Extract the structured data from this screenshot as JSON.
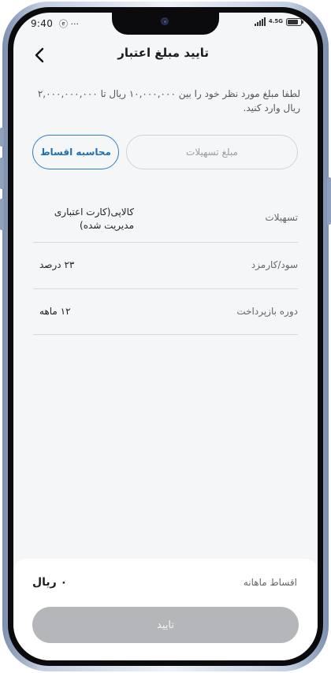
{
  "status_bar": {
    "time": "9:40",
    "left_icons": "ⓔ ···",
    "network_label": "4.5G",
    "battery_level": 0.85
  },
  "header": {
    "title": "تایید مبلغ اعتبار"
  },
  "description": "لطفا مبلغ مورد نظر خود را بین ۱۰,۰۰۰,۰۰۰ ریال تا ۲,۰۰۰,۰۰۰,۰۰۰ ریال وارد کنید.",
  "amount_input": {
    "value": "",
    "placeholder": "مبلغ تسهیلات"
  },
  "calc_button": {
    "label": "محاسبه اقساط"
  },
  "details": [
    {
      "label": "تسهیلات",
      "value": "کالاپی(کارت اعتباری مدیریت شده)"
    },
    {
      "label": "سود/کارمزد",
      "value": "۲۳ درصد"
    },
    {
      "label": "دوره بازپرداخت",
      "value": "۱۲ ماهه"
    }
  ],
  "monthly": {
    "label": "اقساط ماهانه",
    "value": "۰ ریال"
  },
  "confirm_button": {
    "label": "تایید",
    "enabled": false
  },
  "colors": {
    "accent": "#1f6fb2",
    "disabled_button": "#b5b6b9",
    "background": "#f5f6f8"
  }
}
